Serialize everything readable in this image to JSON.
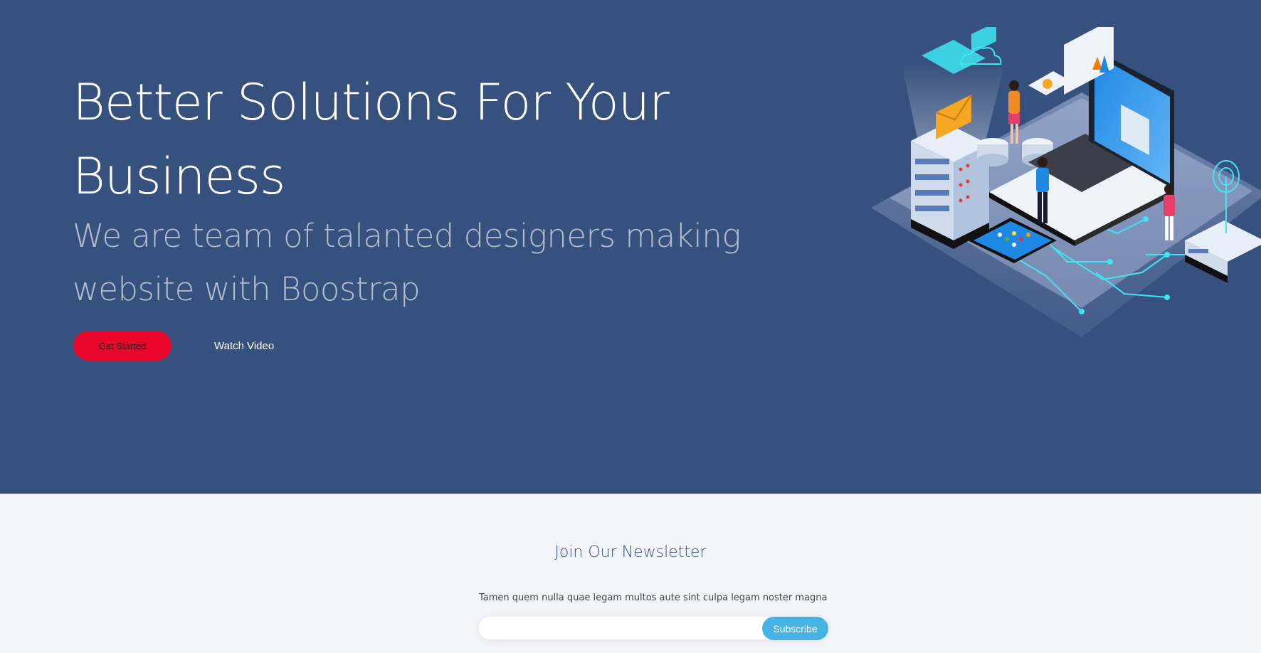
{
  "hero": {
    "title": "Better Solutions For Your Business",
    "subtitle": "We are team of talanted designers making website with Boostrap",
    "primary_button": "Get Started",
    "secondary_button": "Watch Video"
  },
  "newsletter": {
    "title": "Join Our Newsletter",
    "text": "Tamen quem nulla quae legam multos aute sint culpa legam noster magna",
    "input_value": "",
    "input_placeholder": "",
    "button": "Subscribe"
  },
  "colors": {
    "hero_background": "#37517e",
    "page_background": "#f3f5fa",
    "primary_button": "#e8062a",
    "subscribe_button": "#47b2e4",
    "accent_cyan": "#3ee6f2"
  },
  "illustration": {
    "icon": "isometric-business-technology-illustration"
  }
}
